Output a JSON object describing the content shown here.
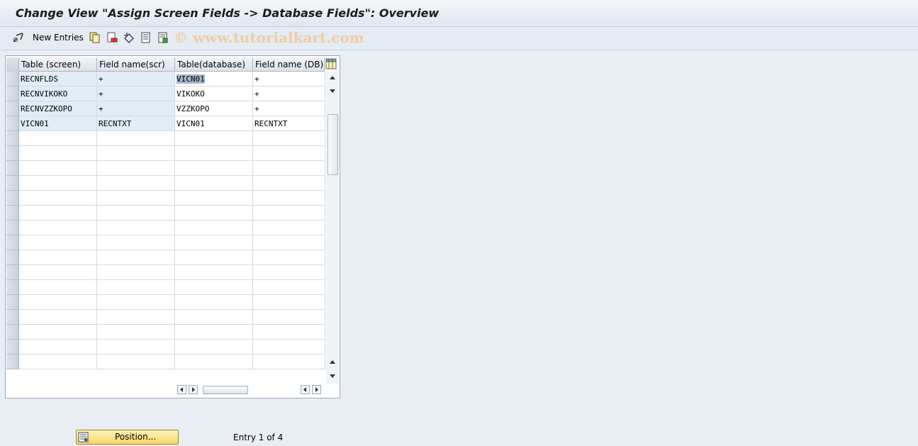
{
  "window": {
    "title": "Change View \"Assign Screen Fields -> Database Fields\": Overview"
  },
  "toolbar": {
    "new_entries_label": "New Entries",
    "icons": [
      "edit-glasses-icon",
      "copy-icon",
      "delete-icon",
      "undo-icon",
      "select-all-icon",
      "deselect-all-icon"
    ],
    "watermark": "© www.tutorialkart.com"
  },
  "table": {
    "columns": [
      "Table (screen)",
      "Field name(scr)",
      "Table(database)",
      "Field name (DB)"
    ],
    "rows": [
      [
        "RECNFLDS",
        "+",
        "VICN01",
        "+"
      ],
      [
        "RECNVIKOKO",
        "+",
        "VIKOKO",
        "+"
      ],
      [
        "RECNVZZKOPO",
        "+",
        "VZZKOPO",
        "+"
      ],
      [
        "VICN01",
        "RECNTXT",
        "VICN01",
        "RECNTXT"
      ]
    ]
  },
  "footer": {
    "position_label": "Position...",
    "entry_text": "Entry 1 of 4"
  },
  "colors": {
    "key_column_bg": "#e2ecf4",
    "position_button": "#f5d66a"
  }
}
